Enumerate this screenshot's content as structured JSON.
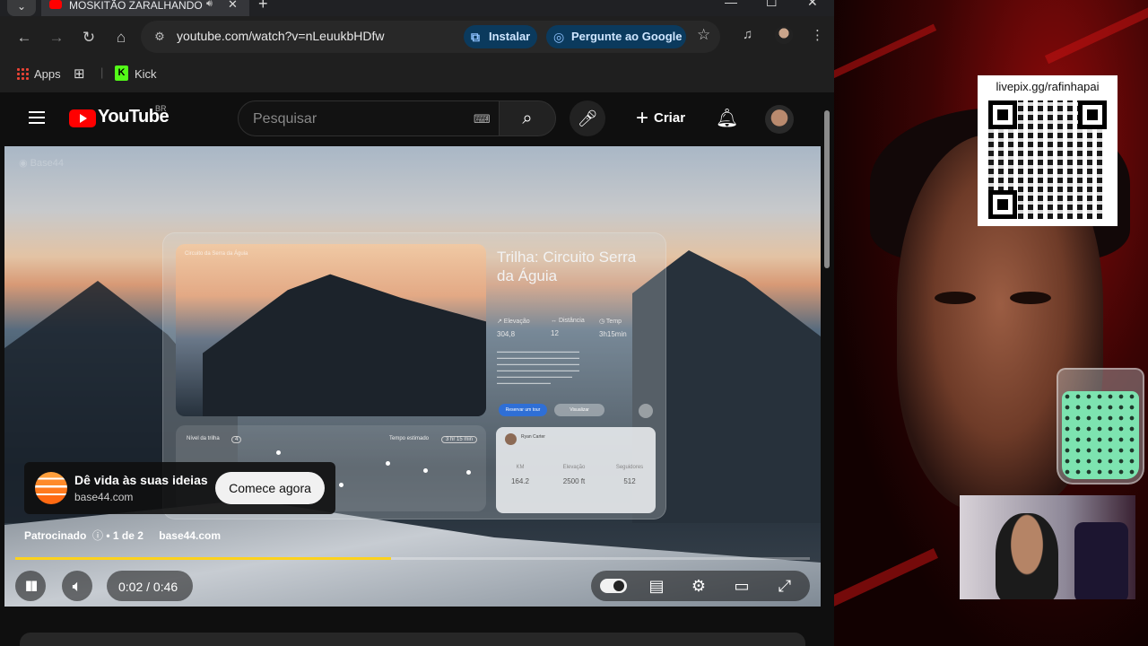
{
  "browser": {
    "tab_title": "MOSKITÃO ZARALHANDO",
    "url": "youtube.com/watch?v=nLeuukbHDfw",
    "install_chip": "Instalar",
    "ask_google_chip": "Pergunte ao Google"
  },
  "bookmarks": {
    "apps": "Apps",
    "kick": "Kick"
  },
  "youtube": {
    "logo_text": "YouTube",
    "country": "BR",
    "search_placeholder": "Pesquisar",
    "create_label": "Criar"
  },
  "video": {
    "mockup": {
      "photo_caption": "Circuito da Serra da Águia",
      "title": "Trilha: Circuito Serra da Águia",
      "stats": [
        {
          "label": "↗ Elevação",
          "value": "304,8"
        },
        {
          "label": "↔ Distância",
          "value": "12"
        },
        {
          "label": "◷ Temp",
          "value": "3h15min"
        }
      ],
      "btn_primary": "Reservar um tour",
      "btn_secondary": "Visualizar",
      "trail_level": "Nível da trilha",
      "trail_level_value": "4",
      "trail_time": "Tempo estimado",
      "trail_time_value": "3 hr 15 min",
      "card_name": "Ryan Carter",
      "card_stats": [
        {
          "label": "KM",
          "value": "164.2"
        },
        {
          "label": "Elevação",
          "value": "2500 ft"
        },
        {
          "label": "Seguidores",
          "value": "512"
        }
      ]
    },
    "ad": {
      "title": "Dê vida às suas ideias",
      "domain": "base44.com",
      "cta": "Comece agora",
      "sponsored": "Patrocinado",
      "position": "• 1 de 2",
      "link": "base44.com"
    },
    "progress": 0.473,
    "time": "0:02 / 0:46"
  },
  "overlay": {
    "qr_label": "livepix.gg/rafinhapai"
  },
  "colors": {
    "progress": "#fcd21d",
    "youtube_red": "#ff0000",
    "chip_bg": "#0b3a5d",
    "kick_green": "#53fc18"
  }
}
